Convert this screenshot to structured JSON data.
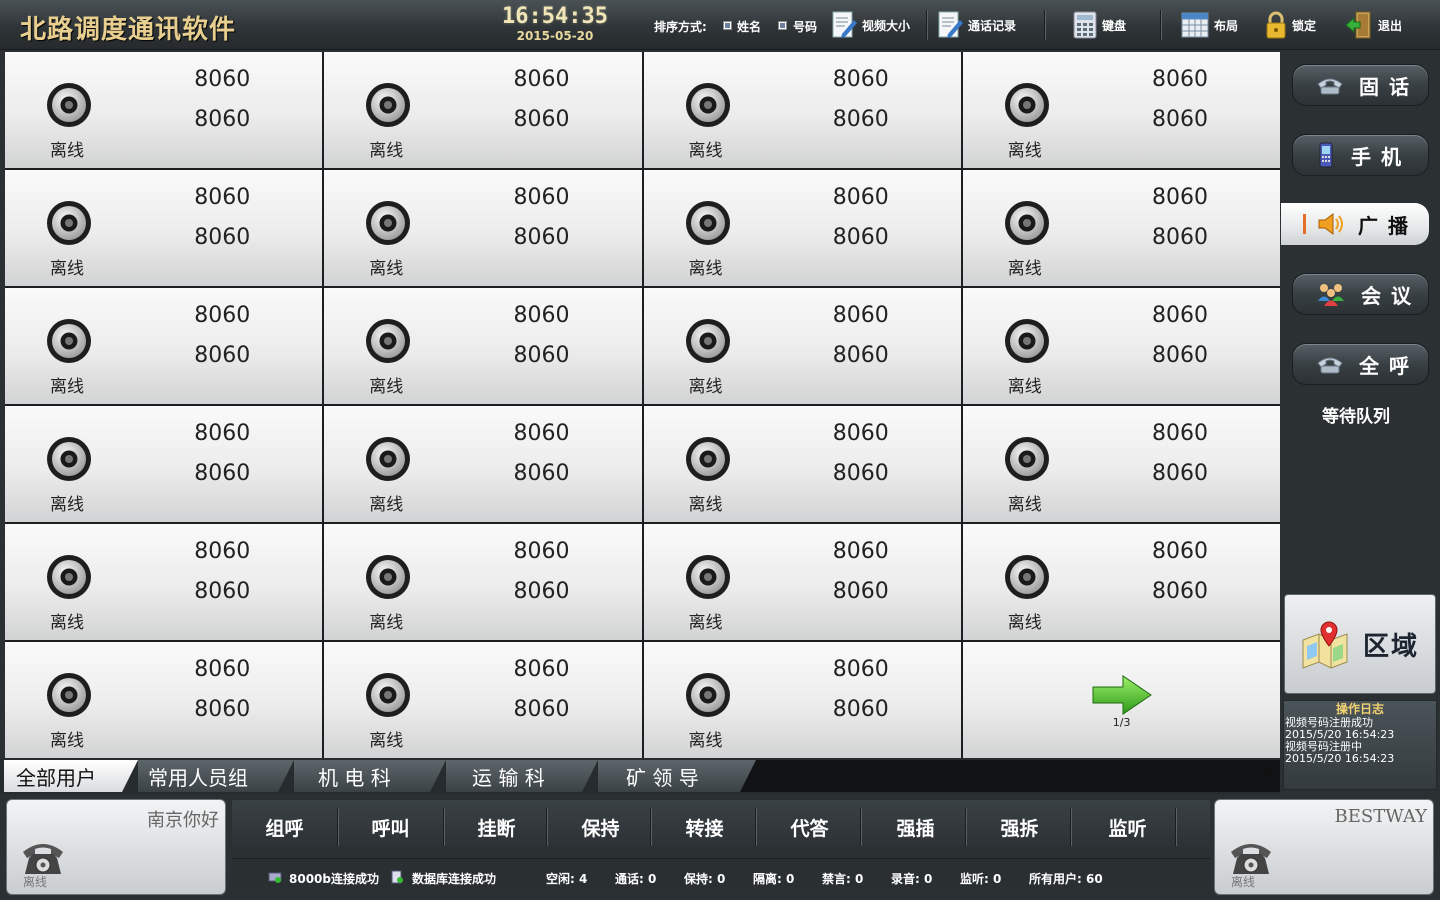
{
  "app": {
    "title": "北路调度通讯软件"
  },
  "clock": {
    "time": "16:54:35",
    "date": "2015-05-20"
  },
  "toolbar": {
    "sort_label": "排序方式:",
    "sort_by_name": "姓名",
    "sort_by_number": "号码",
    "video_size": "视频大小",
    "call_records": "通话记录",
    "keyboard": "键盘",
    "layout": "布局",
    "lock": "锁定",
    "exit": "退出"
  },
  "grid": {
    "cells": [
      {
        "number1": "8060",
        "number2": "8060",
        "status": "离线"
      },
      {
        "number1": "8060",
        "number2": "8060",
        "status": "离线"
      },
      {
        "number1": "8060",
        "number2": "8060",
        "status": "离线"
      },
      {
        "number1": "8060",
        "number2": "8060",
        "status": "离线"
      },
      {
        "number1": "8060",
        "number2": "8060",
        "status": "离线"
      },
      {
        "number1": "8060",
        "number2": "8060",
        "status": "离线"
      },
      {
        "number1": "8060",
        "number2": "8060",
        "status": "离线"
      },
      {
        "number1": "8060",
        "number2": "8060",
        "status": "离线"
      },
      {
        "number1": "8060",
        "number2": "8060",
        "status": "离线"
      },
      {
        "number1": "8060",
        "number2": "8060",
        "status": "离线"
      },
      {
        "number1": "8060",
        "number2": "8060",
        "status": "离线"
      },
      {
        "number1": "8060",
        "number2": "8060",
        "status": "离线"
      },
      {
        "number1": "8060",
        "number2": "8060",
        "status": "离线"
      },
      {
        "number1": "8060",
        "number2": "8060",
        "status": "离线"
      },
      {
        "number1": "8060",
        "number2": "8060",
        "status": "离线"
      },
      {
        "number1": "8060",
        "number2": "8060",
        "status": "离线"
      },
      {
        "number1": "8060",
        "number2": "8060",
        "status": "离线"
      },
      {
        "number1": "8060",
        "number2": "8060",
        "status": "离线"
      },
      {
        "number1": "8060",
        "number2": "8060",
        "status": "离线"
      },
      {
        "number1": "8060",
        "number2": "8060",
        "status": "离线"
      },
      {
        "number1": "8060",
        "number2": "8060",
        "status": "离线"
      },
      {
        "number1": "8060",
        "number2": "8060",
        "status": "离线"
      },
      {
        "number1": "8060",
        "number2": "8060",
        "status": "离线"
      }
    ],
    "page_indicator": "1/3"
  },
  "sidebar": {
    "landline": "固话",
    "mobile": "手机",
    "broadcast": "广播",
    "meeting": "会议",
    "call_all": "全呼",
    "queue": "等待队列",
    "region": "区域"
  },
  "oplog": {
    "title": "操作日志",
    "lines": [
      "视频号码注册成功",
      "2015/5/20 16:54:23",
      "视频号码注册中",
      "2015/5/20 16:54:23"
    ]
  },
  "tabs": [
    "全部用户",
    "常用人员组",
    "机 电 科",
    "运 输 科",
    "矿 领 导"
  ],
  "left_phone": {
    "name": "南京你好",
    "status": "离线"
  },
  "right_phone": {
    "name": "BESTWAY",
    "status": "离线"
  },
  "actions": [
    "组呼",
    "呼叫",
    "挂断",
    "保持",
    "转接",
    "代答",
    "强插",
    "强拆",
    "监听"
  ],
  "statusbar": {
    "conn_8000b": "8000b连接成功",
    "db_conn": "数据库连接成功",
    "idle": "空闲: 4",
    "calling": "通话: 0",
    "hold": "保持: 0",
    "isolate": "隔离: 0",
    "muted": "禁言: 0",
    "record": "录音: 0",
    "monitor": "监听: 0",
    "all_users": "所有用户: 60"
  },
  "colors": {
    "title_gold": "#e9cf8f",
    "broadcast_accent": "#e26f2a",
    "oplog_title": "#f0d070"
  }
}
